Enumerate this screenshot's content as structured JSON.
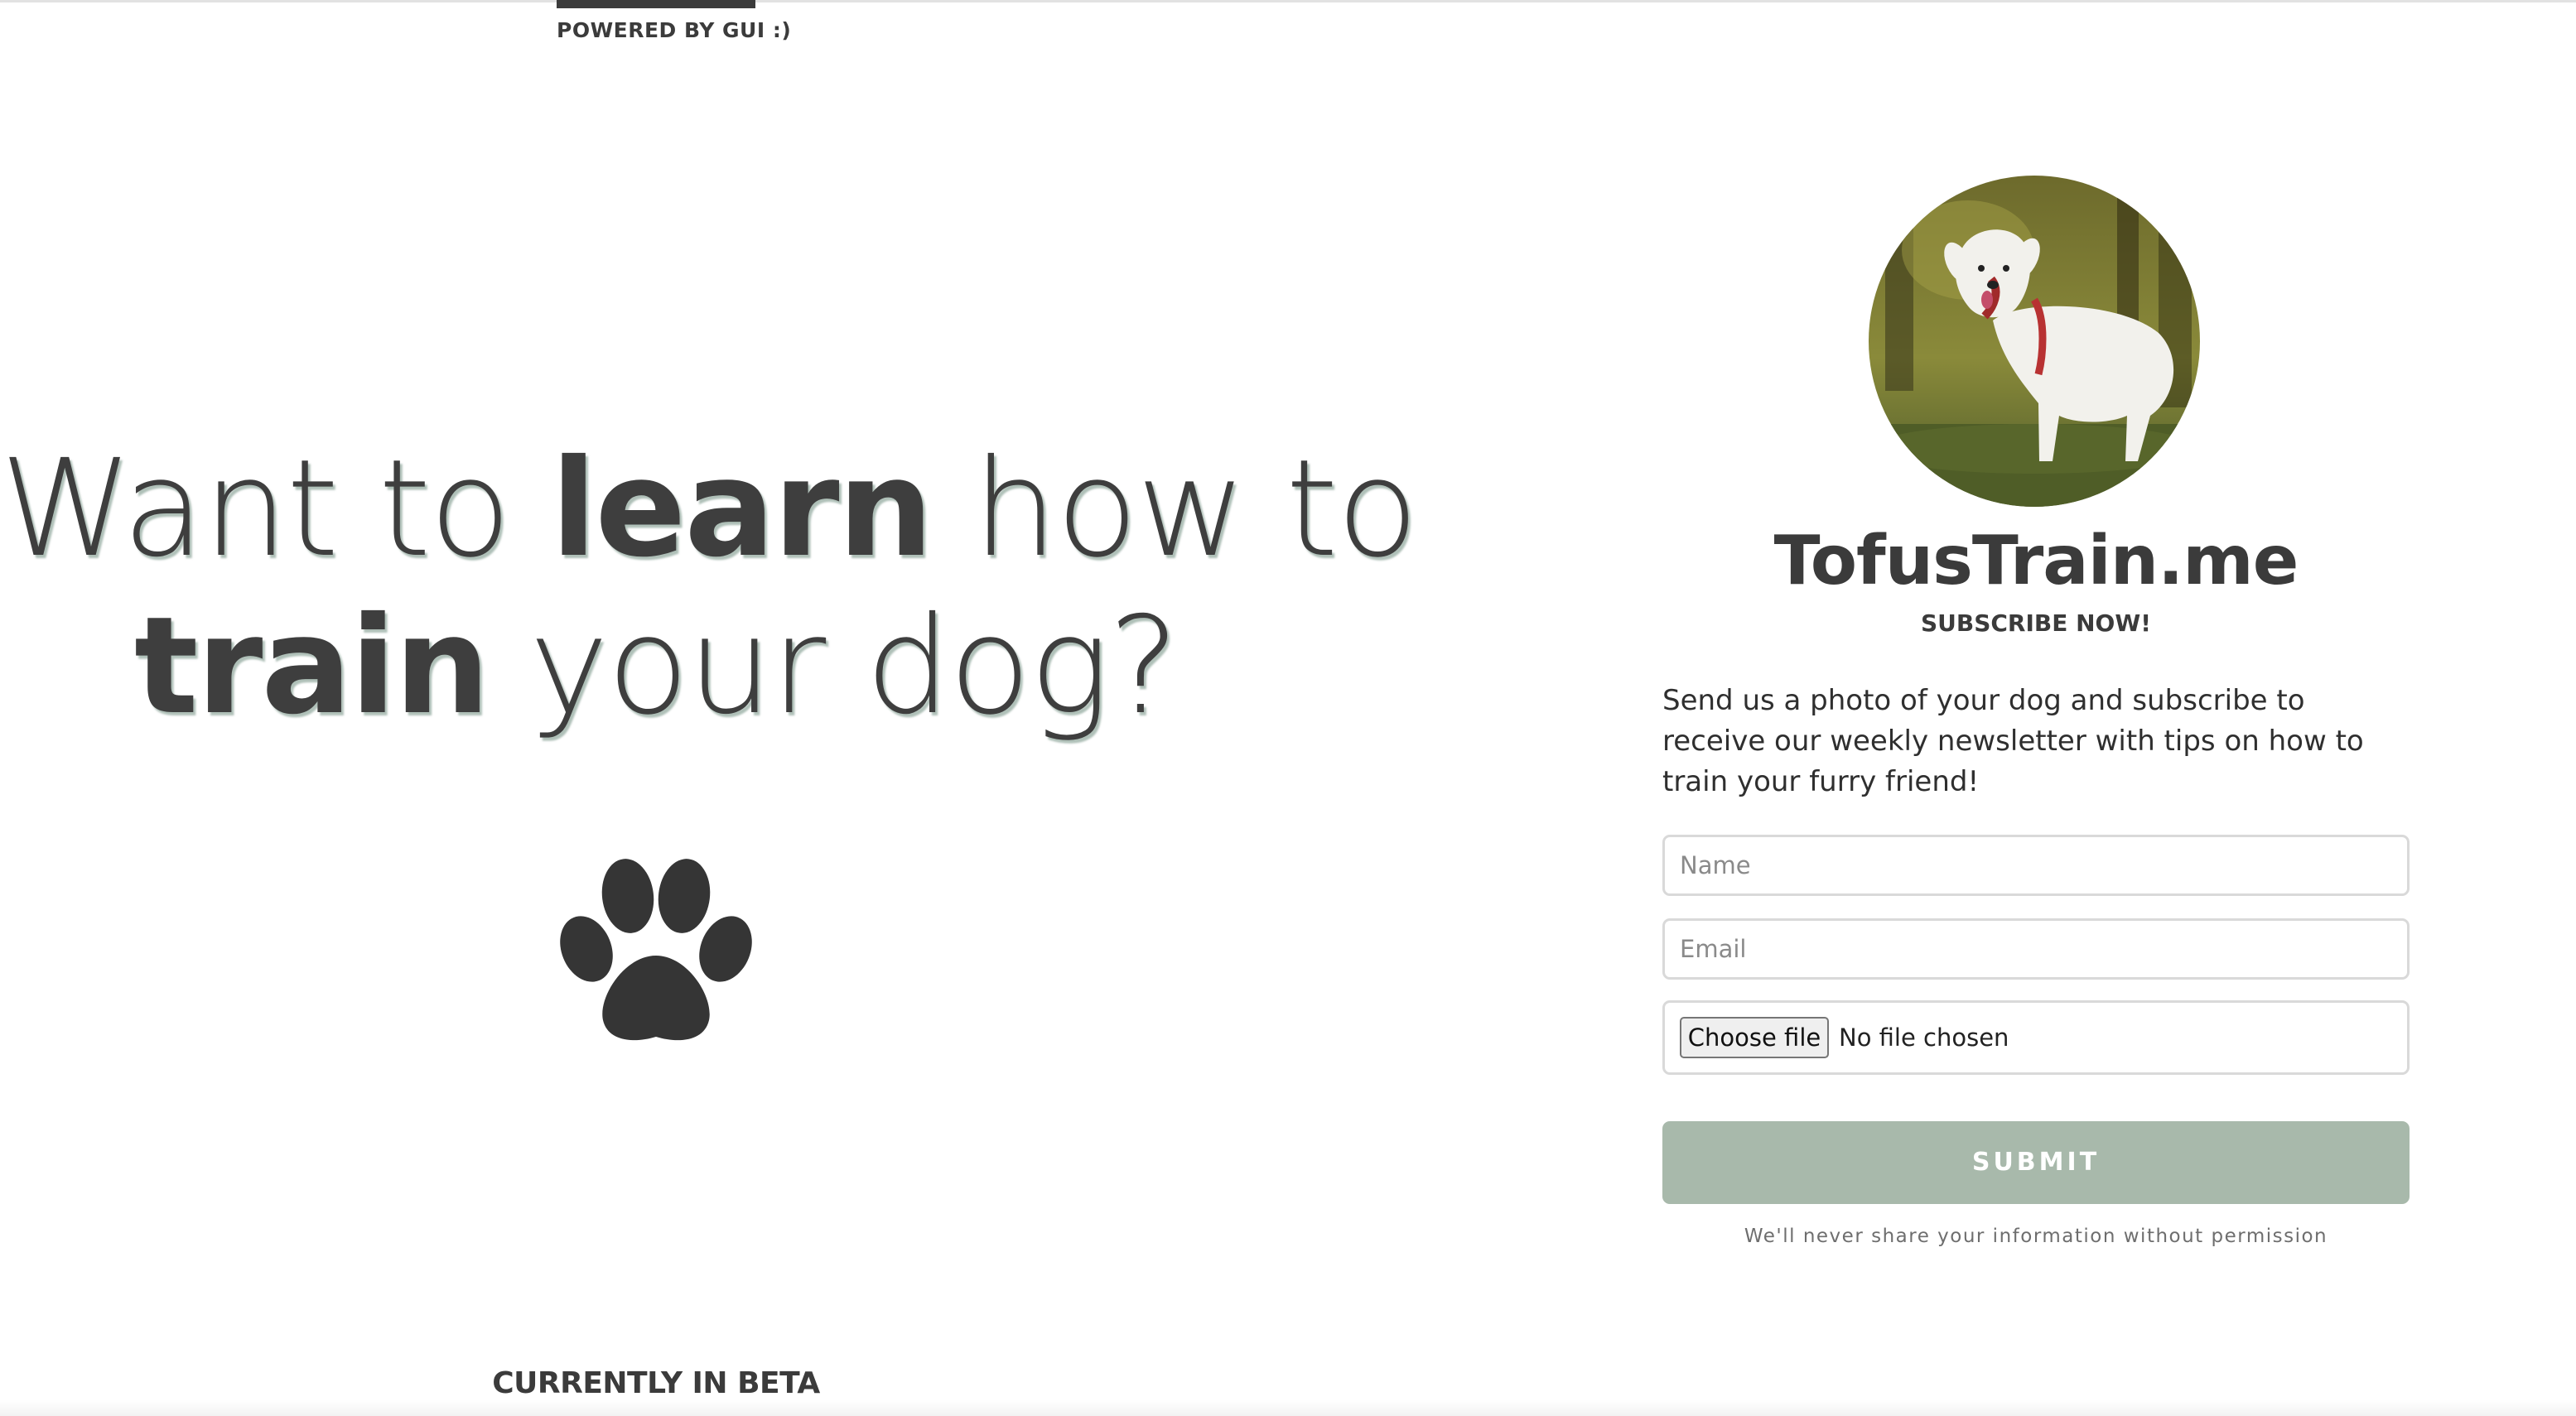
{
  "header": {
    "powered_label": "POWERED BY GUI :)"
  },
  "hero": {
    "line1_part1": "Want to ",
    "line1_bold": "learn",
    "line1_part2": " how to",
    "line2_bold": "train",
    "line2_part2": " your dog?"
  },
  "paw_icon": "paw-print-icon",
  "footer": {
    "beta_label": "CURRENTLY IN BETA"
  },
  "signup": {
    "photo": "dog-photo",
    "brand": "TofusTrain.me",
    "subscribe_label": "SUBSCRIBE NOW!",
    "intro": "Send us a photo of your dog and subscribe to receive our weekly newsletter with tips on how to train your furry friend!",
    "name_placeholder": "Name",
    "email_placeholder": "Email",
    "file_button_label": "Choose file",
    "file_status": "No file chosen",
    "submit_label": "SUBMIT",
    "privacy_note": "We'll never share your information without permission"
  },
  "colors": {
    "text": "#3b3b3b",
    "submit_bg": "#a8b9ab",
    "field_border": "#d9d9d9"
  }
}
